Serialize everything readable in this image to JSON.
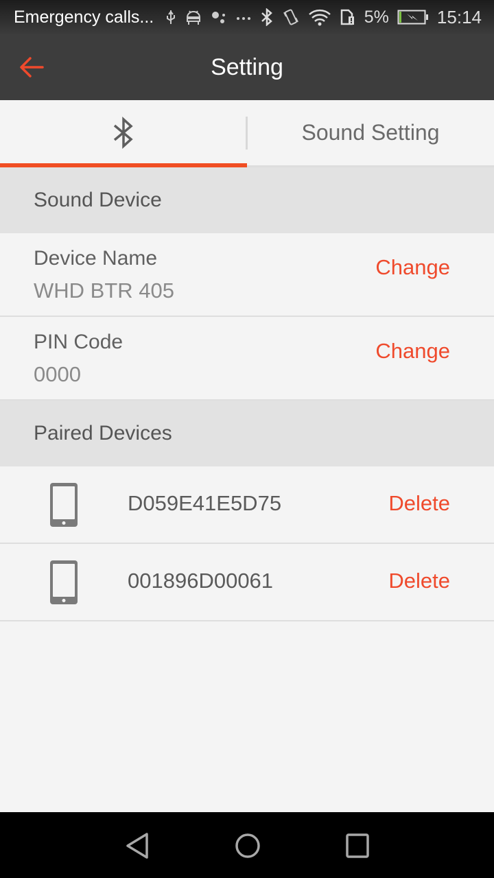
{
  "status_bar": {
    "notification_text": "Emergency calls...",
    "icons": [
      "usb-icon",
      "android-debug-icon",
      "assistant-icon",
      "more-notifications-icon",
      "bluetooth-icon",
      "vibrate-icon",
      "wifi-icon",
      "sim-alert-icon"
    ],
    "battery_percent": "5%",
    "battery_level": 0.05,
    "charging": true,
    "time": "15:14"
  },
  "app_bar": {
    "title": "Setting",
    "back_icon": "arrow-left-icon"
  },
  "tabs": [
    {
      "label": "",
      "icon": "bluetooth-icon",
      "active": true
    },
    {
      "label": "Sound Setting",
      "active": false
    }
  ],
  "sound_device": {
    "header": "Sound Device",
    "items": [
      {
        "label": "Device Name",
        "value": "WHD BTR 405",
        "action": "Change"
      },
      {
        "label": "PIN Code",
        "value": "0000",
        "action": "Change"
      }
    ]
  },
  "paired_devices": {
    "header": "Paired Devices",
    "items": [
      {
        "icon": "smartphone-icon",
        "id": "D059E41E5D75",
        "action": "Delete"
      },
      {
        "icon": "smartphone-icon",
        "id": "001896D00061",
        "action": "Delete"
      }
    ]
  },
  "nav_bar": {
    "buttons": [
      "back",
      "home",
      "recents"
    ]
  },
  "colors": {
    "accent": "#ef4a2c",
    "app_bar": "#3d3d3d",
    "section_bg": "#e2e2e2",
    "content_bg": "#f4f4f4"
  }
}
